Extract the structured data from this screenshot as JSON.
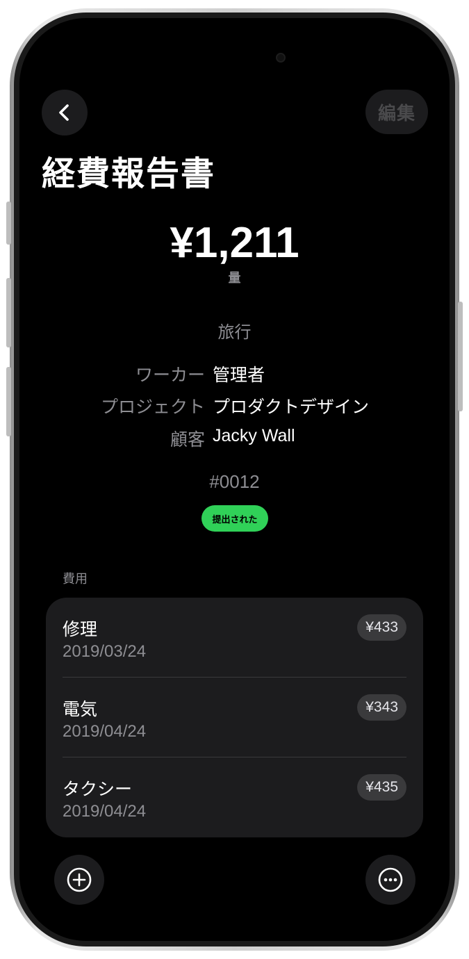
{
  "nav": {
    "edit_label": "編集"
  },
  "page": {
    "title": "経費報告書"
  },
  "summary": {
    "amount": "¥1,211",
    "amount_label": "量",
    "category": "旅行"
  },
  "details": [
    {
      "key": "ワーカー",
      "value": "管理者"
    },
    {
      "key": "プロジェクト",
      "value": "プロダクトデザイン"
    },
    {
      "key": "顧客",
      "value": "Jacky Wall"
    }
  ],
  "report": {
    "id": "#0012",
    "status": "提出された"
  },
  "expenses": {
    "section_label": "費用",
    "items": [
      {
        "name": "修理",
        "date": "2019/03/24",
        "amount": "¥433"
      },
      {
        "name": "電気",
        "date": "2019/04/24",
        "amount": "¥343"
      },
      {
        "name": "タクシー",
        "date": "2019/04/24",
        "amount": "¥435"
      }
    ]
  },
  "colors": {
    "status_green": "#30d158",
    "card_bg": "#1c1c1e",
    "screen_bg": "#000000"
  },
  "icons": {
    "back": "chevron-left-icon",
    "add": "plus-circle-icon",
    "more": "ellipsis-circle-icon"
  }
}
